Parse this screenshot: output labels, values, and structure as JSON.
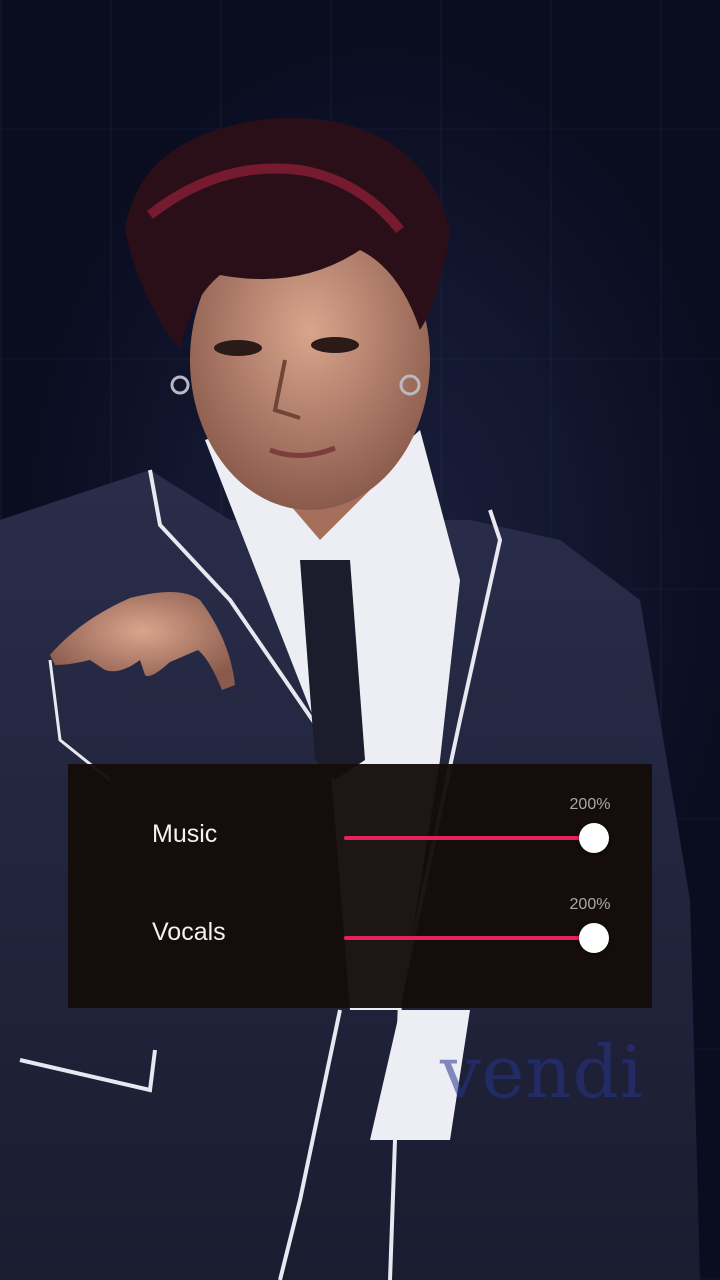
{
  "mixer": {
    "music": {
      "label": "Music",
      "value_text": "200%",
      "level": 1.0
    },
    "vocals": {
      "label": "Vocals",
      "value_text": "200%",
      "level": 1.0
    }
  },
  "watermark": "vendi",
  "colors": {
    "accent": "#e8215a",
    "panel": "#140c0a",
    "background": "#0c1024"
  }
}
